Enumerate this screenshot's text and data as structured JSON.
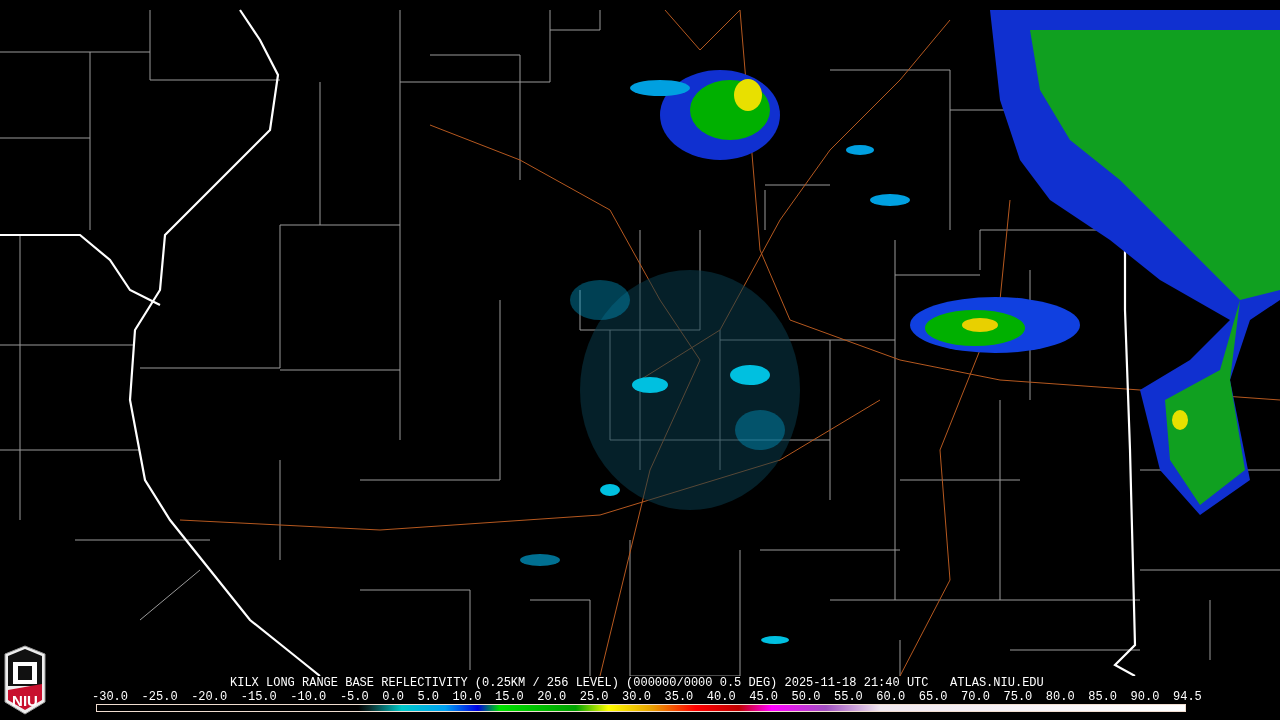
{
  "logo": {
    "text": "NIU"
  },
  "caption": "KILX LONG RANGE BASE REFLECTIVITY (0.25KM / 256 LEVEL) (000000/0000 0.5 DEG) 2025-11-18 21:40 UTC   ATLAS.NIU.EDU",
  "legend": {
    "ticks": [
      "-30.0",
      "-25.0",
      "-20.0",
      "-15.0",
      "-10.0",
      "-5.0",
      "0.0",
      "5.0",
      "10.0",
      "15.0",
      "20.0",
      "25.0",
      "30.0",
      "35.0",
      "40.0",
      "45.0",
      "50.0",
      "55.0",
      "60.0",
      "65.0",
      "70.0",
      "75.0",
      "80.0",
      "85.0",
      "90.0",
      "94.5"
    ]
  }
}
